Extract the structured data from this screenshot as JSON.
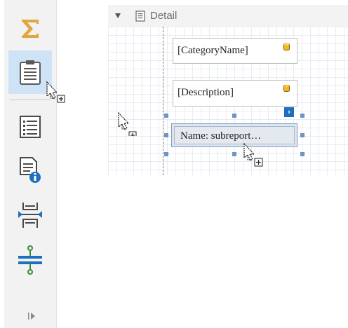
{
  "toolbox": {
    "items": [
      {
        "name": "summary-tool",
        "icon": "sigma-icon"
      },
      {
        "name": "subreport-tool",
        "icon": "clipboard-icon",
        "selected": true
      },
      {
        "name": "table-of-contents-tool",
        "icon": "document-list-icon"
      },
      {
        "name": "report-info-tool",
        "icon": "document-info-icon"
      },
      {
        "name": "page-break-tool",
        "icon": "page-break-icon"
      },
      {
        "name": "cross-band-line-tool",
        "icon": "line-divider-icon"
      }
    ],
    "expand_icon": "expand-arrow-icon"
  },
  "band": {
    "title": "Detail"
  },
  "controls": {
    "category_label": "[CategoryName]",
    "description_label": "[Description]",
    "subreport_label": "Name: subreport…"
  },
  "colors": {
    "accent": "#1d6fc0",
    "selection": "#cfe3f6",
    "sigma": "#e0a640",
    "handle": "#6f93c2"
  }
}
